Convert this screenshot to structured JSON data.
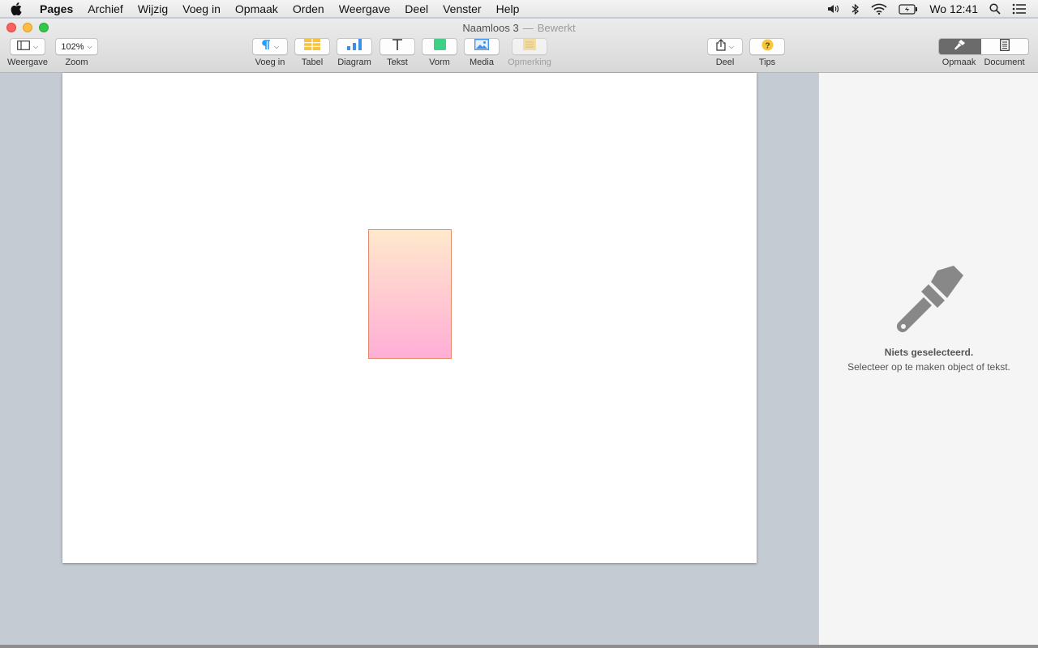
{
  "menubar": {
    "app_name": "Pages",
    "items": [
      "Archief",
      "Wijzig",
      "Voeg in",
      "Opmaak",
      "Orden",
      "Weergave",
      "Deel",
      "Venster",
      "Help"
    ],
    "clock": "Wo 12:41"
  },
  "window": {
    "title": "Naamloos 3",
    "separator": "—",
    "status": "Bewerkt"
  },
  "toolbar": {
    "view_label": "Weergave",
    "zoom_value": "102%",
    "zoom_label": "Zoom",
    "insert_label": "Voeg in",
    "table_label": "Tabel",
    "chart_label": "Diagram",
    "text_label": "Tekst",
    "shape_label": "Vorm",
    "media_label": "Media",
    "comment_label": "Opmerking",
    "share_label": "Deel",
    "tips_label": "Tips",
    "format_label": "Opmaak",
    "document_label": "Document"
  },
  "inspector": {
    "title": "Niets geselecteerd.",
    "subtitle": "Selecteer op te maken object of tekst."
  },
  "colors": {
    "shape_top": "#ffe9cc",
    "shape_bottom": "#ffaed6",
    "shape_border": "#e58a6c",
    "canvas_bg": "#c4cbd3"
  }
}
